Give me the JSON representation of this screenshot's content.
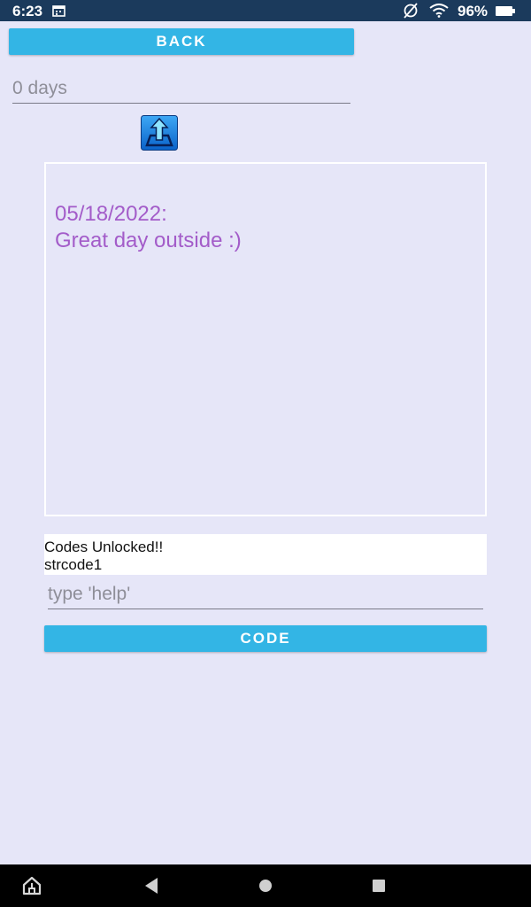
{
  "status_bar": {
    "time": "6:23",
    "battery": "96%",
    "icons": [
      "calendar-icon",
      "no-sim-icon",
      "wifi-icon",
      "battery-icon"
    ]
  },
  "back_button": {
    "label": "BACK"
  },
  "days_field": {
    "value": "0 days"
  },
  "upload_icon": "upload-icon",
  "journal": {
    "date": "05/18/2022:",
    "entry": "Great day outside :)",
    "text_color": "#a35cc9"
  },
  "codes": {
    "line1": "Codes Unlocked!!",
    "line2": "strcode1"
  },
  "help_input": {
    "placeholder": "type 'help'",
    "value": ""
  },
  "code_button": {
    "label": "CODE"
  },
  "nav_bar": {
    "icons": [
      "home-icon",
      "back-icon",
      "home-circle-icon",
      "recents-icon"
    ]
  },
  "colors": {
    "background": "#e6e6f8",
    "accent": "#33b5e5",
    "status_bar": "#1b3a5c"
  }
}
